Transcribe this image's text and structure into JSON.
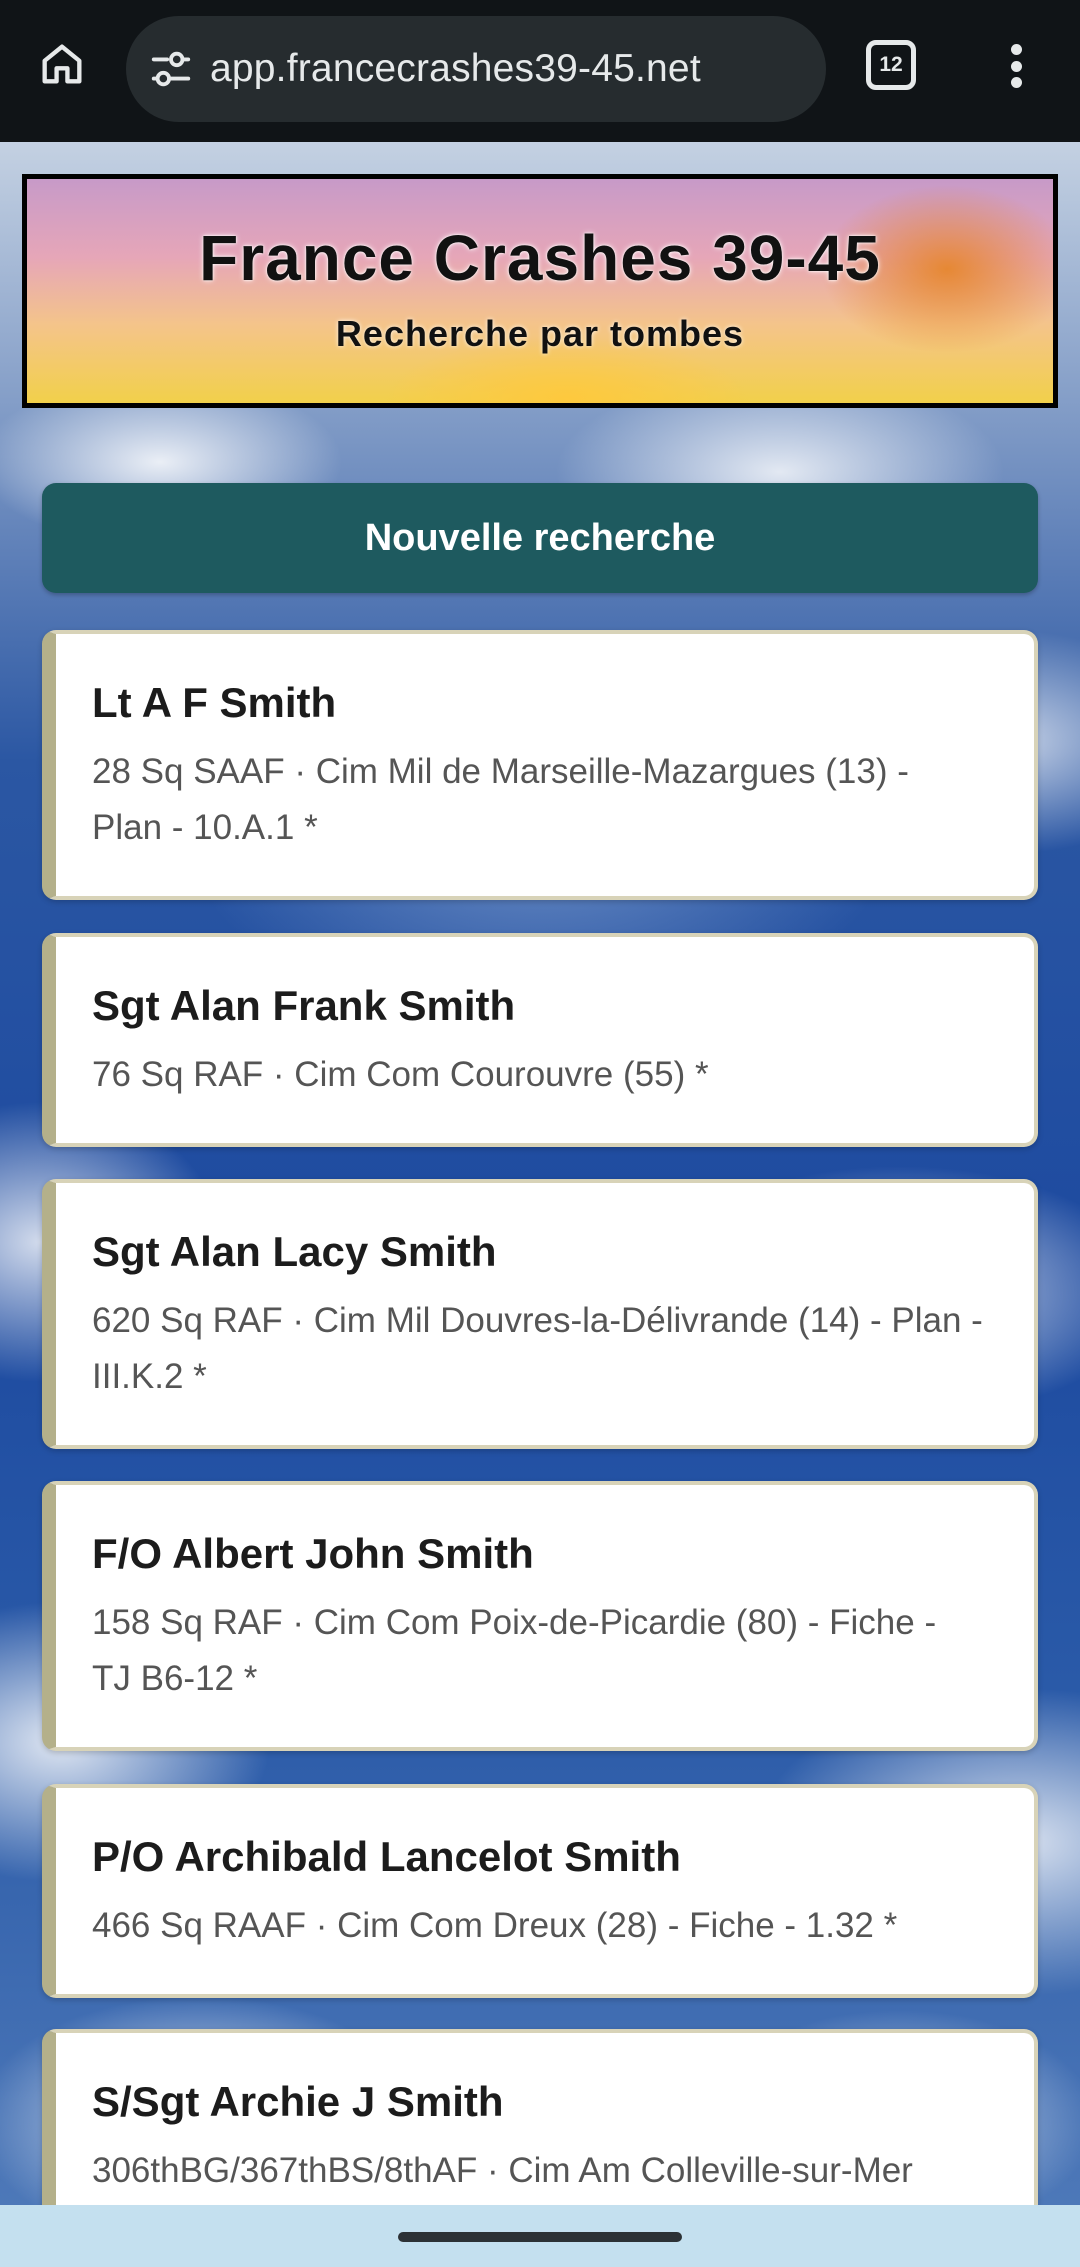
{
  "browser": {
    "url": "app.francecrashes39-45.net",
    "tab_count": "12",
    "icons": {
      "home": "home-icon",
      "site_info": "tune-icon",
      "tabs": "tab-switcher-icon",
      "menu": "more-vert-icon"
    }
  },
  "banner": {
    "title": "France Crashes 39-45",
    "subtitle": "Recherche par tombes"
  },
  "new_search_label": "Nouvelle recherche",
  "results": [
    {
      "name": "Lt A F Smith",
      "details": "28 Sq SAAF · Cim Mil de Marseille-Mazargues (13) - Plan - 10.A.1 *"
    },
    {
      "name": "Sgt Alan Frank Smith",
      "details": "76 Sq RAF · Cim Com Courouvre (55) *"
    },
    {
      "name": "Sgt Alan Lacy Smith",
      "details": "620 Sq RAF · Cim Mil Douvres-la-Délivrande (14) - Plan - III.K.2 *"
    },
    {
      "name": "F/O Albert John Smith",
      "details": "158 Sq RAF · Cim Com Poix-de-Picardie (80) - Fiche - TJ B6-12 *"
    },
    {
      "name": "P/O Archibald Lancelot Smith",
      "details": "466 Sq RAAF · Cim Com Dreux (28) - Fiche - 1.32 *"
    },
    {
      "name": "S/Sgt Archie J Smith",
      "details": "306thBG/367thBS/8thAF · Cim Am Colleville-sur-Mer"
    }
  ],
  "colors": {
    "button_bg": "#1e5a5f",
    "card_accent": "#b4b08a",
    "card_border": "#d8d3b8",
    "toolbar_bg": "#101417",
    "navbar_bg": "#c4e0ef"
  }
}
